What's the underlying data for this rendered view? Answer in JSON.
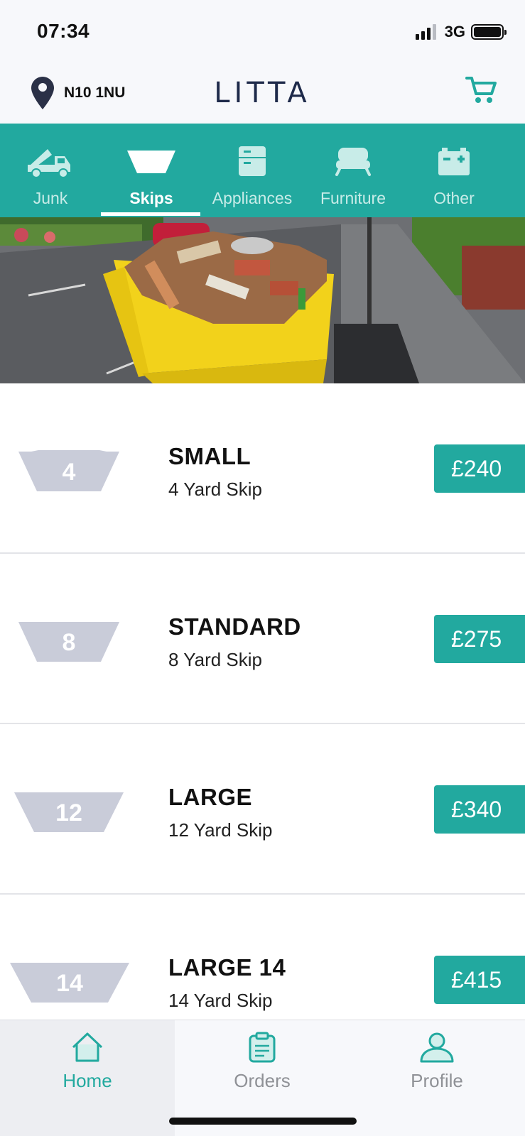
{
  "status_bar": {
    "time": "07:34",
    "network": "3G"
  },
  "header": {
    "location": "N10 1NU",
    "brand": "LITTA"
  },
  "categories": [
    {
      "label": "Junk",
      "icon": "truck-icon",
      "active": false
    },
    {
      "label": "Skips",
      "icon": "skip-icon",
      "active": true
    },
    {
      "label": "Appliances",
      "icon": "fridge-icon",
      "active": false
    },
    {
      "label": "Furniture",
      "icon": "sofa-icon",
      "active": false
    },
    {
      "label": "Other",
      "icon": "battery-icon",
      "active": false
    }
  ],
  "skips": [
    {
      "size": "4",
      "name": "SMALL",
      "desc": "4 Yard Skip",
      "price": "£240"
    },
    {
      "size": "8",
      "name": "STANDARD",
      "desc": "8 Yard Skip",
      "price": "£275"
    },
    {
      "size": "12",
      "name": "LARGE",
      "desc": "12 Yard Skip",
      "price": "£340"
    },
    {
      "size": "14",
      "name": "LARGE 14",
      "desc": "14 Yard Skip",
      "price": "£415"
    }
  ],
  "bottom_nav": [
    {
      "label": "Home",
      "icon": "home-icon",
      "active": true
    },
    {
      "label": "Orders",
      "icon": "clipboard-icon",
      "active": false
    },
    {
      "label": "Profile",
      "icon": "person-icon",
      "active": false
    }
  ],
  "colors": {
    "accent": "#22a99f",
    "brand": "#1e2a4a",
    "badge": "#c9ccd9"
  }
}
